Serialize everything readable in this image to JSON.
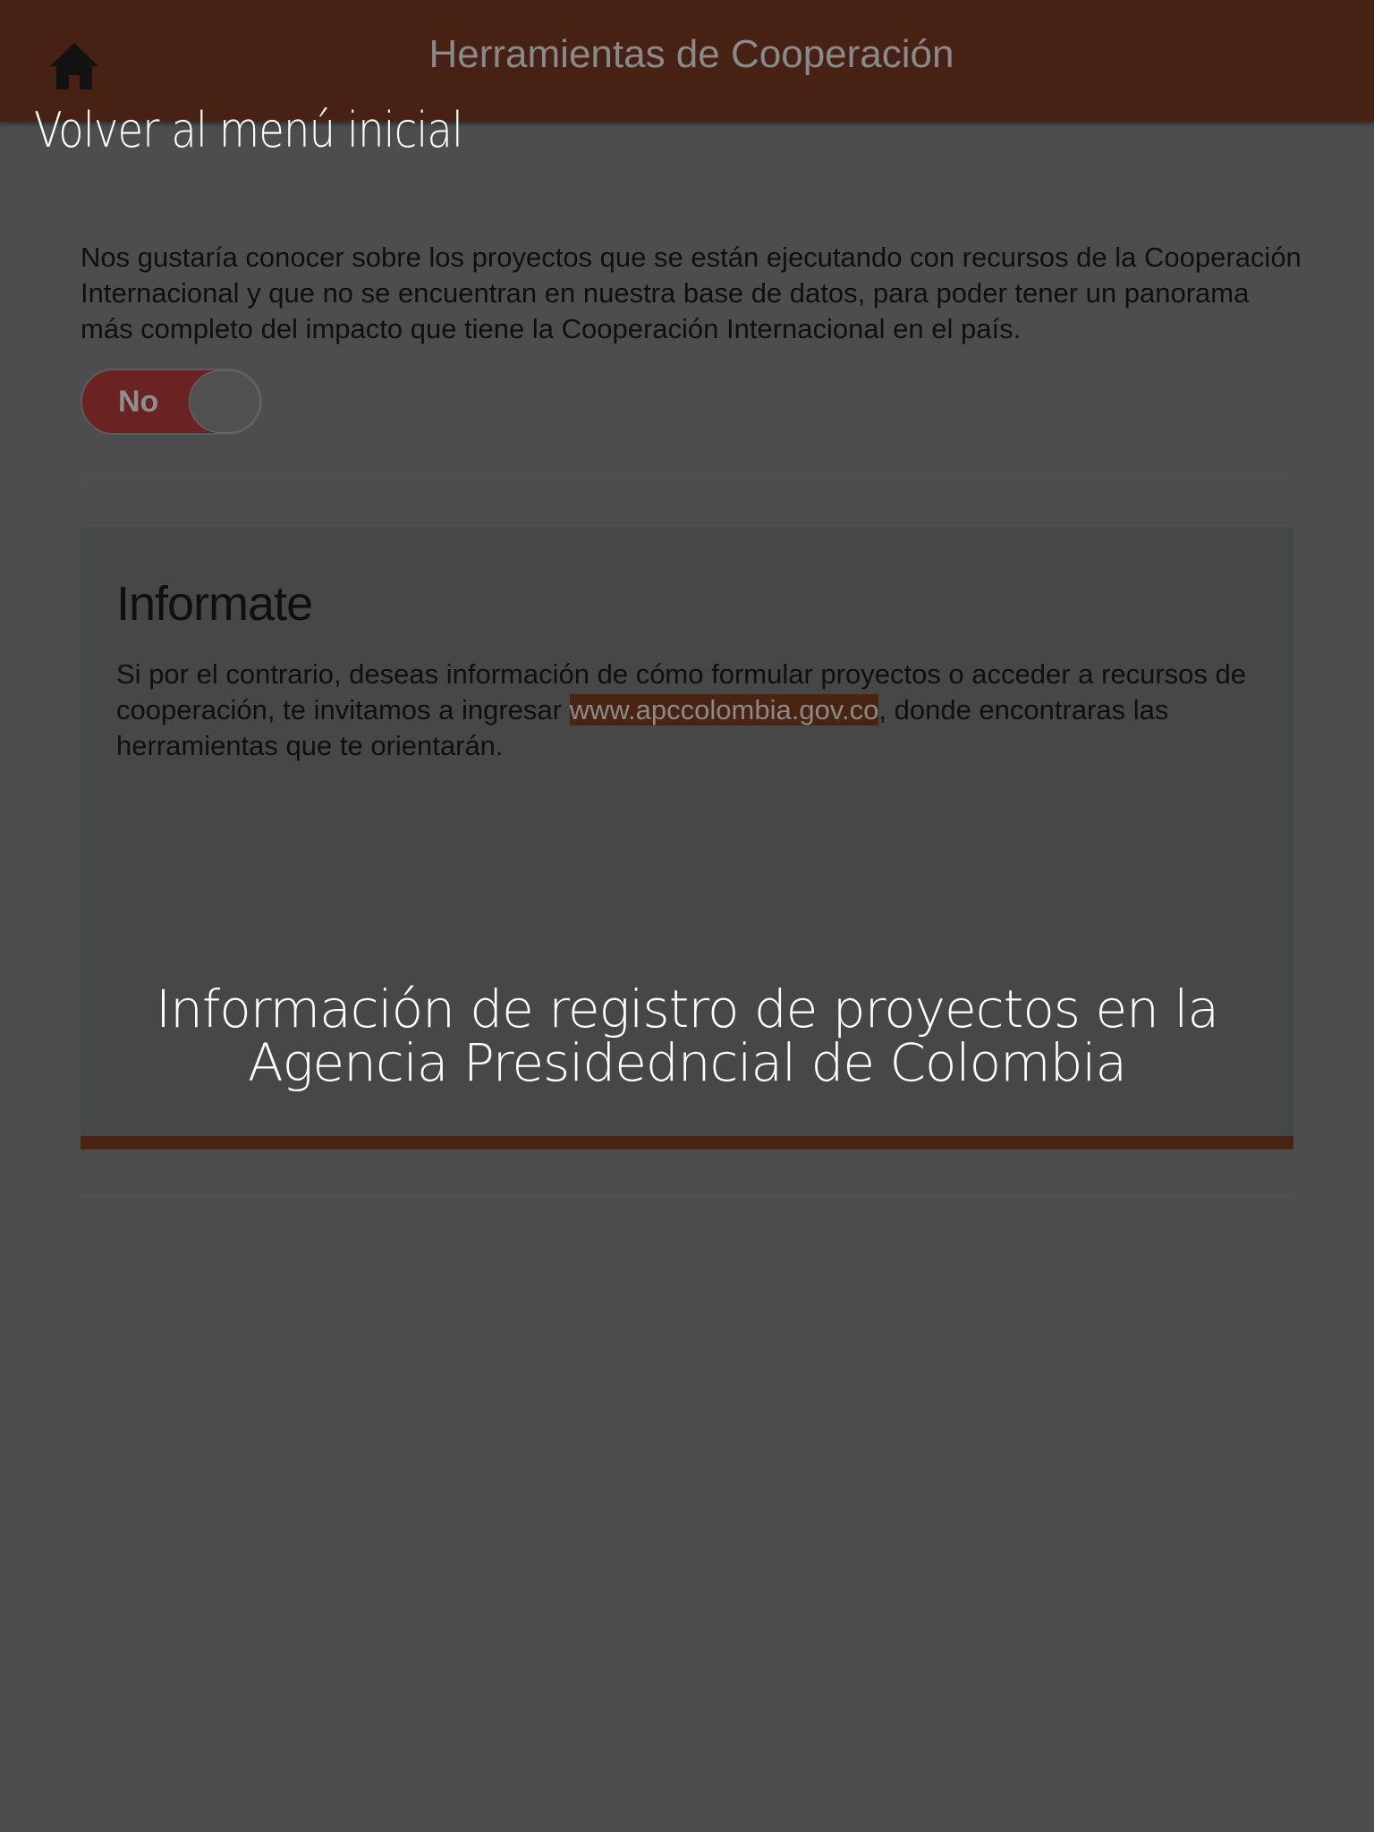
{
  "header": {
    "title": "Herramientas de Cooperación",
    "home_icon": "home-icon",
    "background": "#472214"
  },
  "overlay_hints": {
    "home": "Volver al menú inicial",
    "projects_line1": "Información de registro de proyectos en la",
    "projects_line2": "Agencia Presidedncial de Colombia"
  },
  "intro": {
    "text": "Nos gustaría conocer sobre los proyectos que se están ejecutando con recursos de la Cooperación Internacional y que no se encuentran en nuestra base de datos, para poder tener un panorama más completo del impacto que tiene la Cooperación Internacional en el país."
  },
  "toggle": {
    "label": "No",
    "state": "off"
  },
  "info": {
    "title": "Informate",
    "text_before_link": "Si por el contrario, deseas información de cómo formular proyectos o acceder a recursos de cooperación, te invitamos a ingresar ",
    "link": "www.apccolombia.gov.co",
    "text_after_link": ", donde encontraras las herramientas que te orientarán.",
    "accent_color": "#4a2412"
  }
}
